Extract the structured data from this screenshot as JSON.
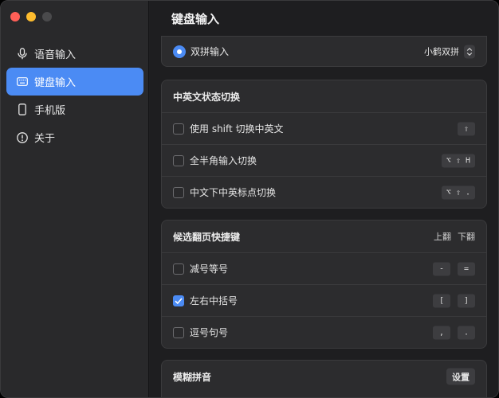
{
  "window": {
    "title": "键盘输入"
  },
  "sidebar": {
    "items": [
      {
        "label": "语音输入",
        "icon": "microphone-icon",
        "active": false
      },
      {
        "label": "键盘输入",
        "icon": "keyboard-icon",
        "active": true
      },
      {
        "label": "手机版",
        "icon": "phone-icon",
        "active": false
      },
      {
        "label": "关于",
        "icon": "info-icon",
        "active": false
      }
    ]
  },
  "pinyin": {
    "label": "双拼输入",
    "scheme": "小鹤双拼"
  },
  "lang_switch": {
    "title": "中英文状态切换",
    "rows": [
      {
        "label": "使用 shift 切换中英文",
        "keys": [
          "⇧"
        ],
        "checked": false
      },
      {
        "label": "全半角输入切换",
        "keys": [
          "⌥",
          "⇧",
          "H"
        ],
        "checked": false
      },
      {
        "label": "中文下中英标点切换",
        "keys": [
          "⌥",
          "⇧",
          "."
        ],
        "checked": false
      }
    ]
  },
  "paging": {
    "title": "候选翻页快捷键",
    "col_prev": "上翻",
    "col_next": "下翻",
    "rows": [
      {
        "label": "减号等号",
        "prev": "-",
        "next": "=",
        "checked": false
      },
      {
        "label": "左右中括号",
        "prev": "[",
        "next": "]",
        "checked": true
      },
      {
        "label": "逗号句号",
        "prev": ",",
        "next": ".",
        "checked": false
      }
    ]
  },
  "fuzzy": {
    "title": "模糊拼音",
    "button": "设置"
  },
  "colors": {
    "accent": "#4b8bf4",
    "sidebar_bg": "#29292b",
    "card_bg": "#2c2c2e"
  }
}
